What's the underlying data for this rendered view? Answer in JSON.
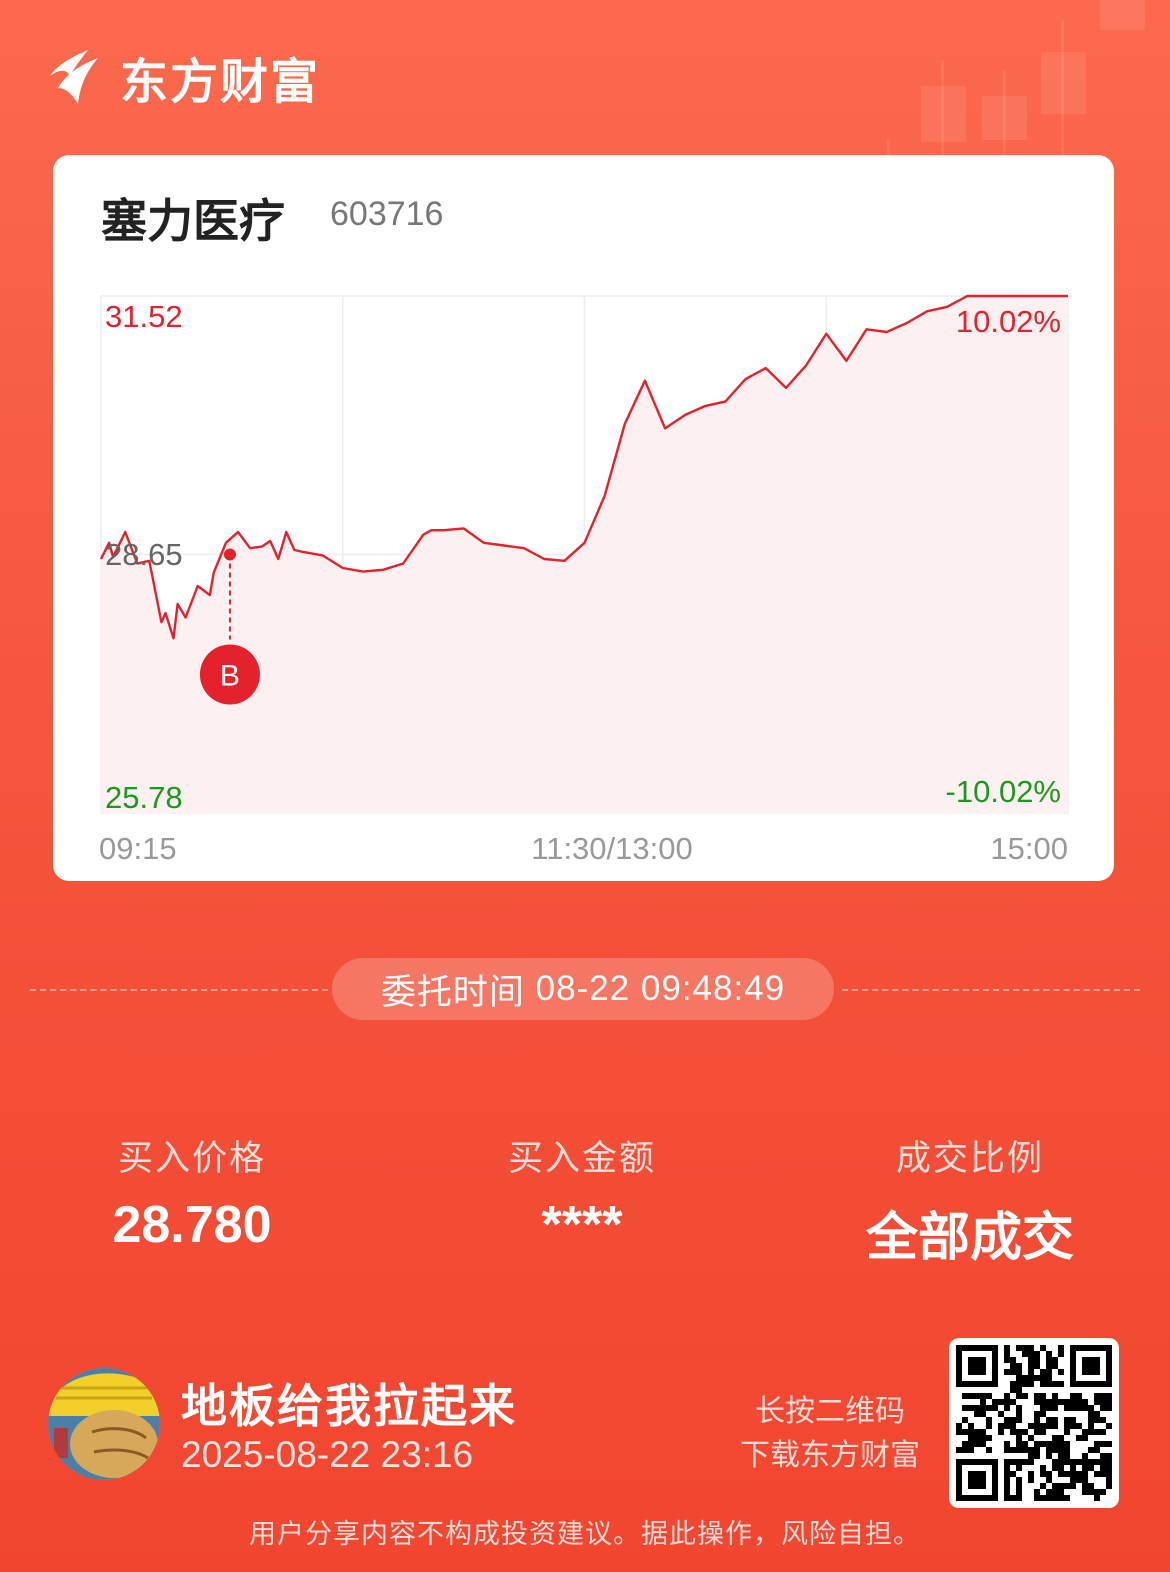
{
  "brand": {
    "name": "东方财富",
    "logo_icon": "eastmoney-flame-logo"
  },
  "stock": {
    "name": "塞力医疗",
    "code": "603716"
  },
  "chart_data": {
    "type": "line",
    "title": "",
    "y_labels": {
      "high": "31.52",
      "mid": "28.65",
      "low": "25.78"
    },
    "pct_labels": {
      "high": "10.02%",
      "low": "-10.02%"
    },
    "x_labels": [
      "09:15",
      "11:30/13:00",
      "15:00"
    ],
    "ylim": [
      25.78,
      31.52
    ],
    "prev_close": 28.65,
    "series": [
      {
        "x": [
          0,
          2,
          3,
          6,
          9,
          12,
          15,
          16,
          18,
          19,
          21,
          24,
          27,
          28,
          31,
          34,
          37,
          40,
          42,
          44,
          46,
          48,
          50,
          55,
          60,
          65,
          70,
          75,
          80,
          82,
          85,
          90,
          95,
          100,
          105,
          110,
          115,
          120,
          125,
          130,
          135,
          140,
          145,
          150,
          155,
          160,
          165,
          170,
          175,
          180,
          185,
          190,
          195,
          200,
          205,
          210,
          215,
          220,
          225,
          230,
          235,
          240
        ],
        "values": [
          28.6,
          28.78,
          28.62,
          28.9,
          28.55,
          28.58,
          27.9,
          28.0,
          27.72,
          28.1,
          27.95,
          28.3,
          28.2,
          28.45,
          28.78,
          28.9,
          28.72,
          28.74,
          28.8,
          28.6,
          28.9,
          28.7,
          28.68,
          28.64,
          28.5,
          28.46,
          28.48,
          28.55,
          28.87,
          28.92,
          28.92,
          28.94,
          28.78,
          28.75,
          28.72,
          28.6,
          28.58,
          28.78,
          29.3,
          30.1,
          30.58,
          30.05,
          30.2,
          30.3,
          30.35,
          30.6,
          30.72,
          30.5,
          30.75,
          31.1,
          30.8,
          31.15,
          31.12,
          31.22,
          31.35,
          31.4,
          31.52,
          31.52,
          31.52,
          31.52,
          31.52,
          31.52
        ]
      }
    ],
    "buy_marker": {
      "label": "B",
      "x": 32,
      "value": 28.65
    },
    "line_color": "#e5212b",
    "grid": true
  },
  "order": {
    "label": "委托时间",
    "time": "08-22 09:48:49"
  },
  "stats": [
    {
      "label": "买入价格",
      "value": "28.780"
    },
    {
      "label": "买入金额",
      "value": "****"
    },
    {
      "label": "成交比例",
      "value": "全部成交"
    }
  ],
  "user": {
    "name": "地板给我拉起来",
    "datetime": "2025-08-22 23:16",
    "avatar_icon": "cartoon-fist-avatar"
  },
  "qr": {
    "tip_line1": "长按二维码",
    "tip_line2": "下载东方财富",
    "icon": "qr-code"
  },
  "disclaimer": "用户分享内容不构成投资建议。据此操作，风险自担。",
  "colors": {
    "up": "#e5212b",
    "down": "#1a9a1a",
    "neutral": "#666666",
    "accent": "#f6553d"
  }
}
